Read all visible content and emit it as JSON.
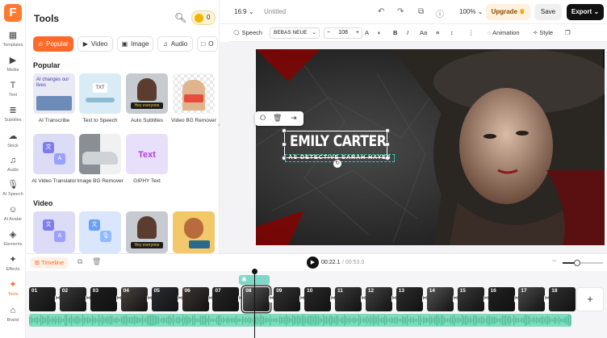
{
  "rail": {
    "items": [
      {
        "label": "Templates",
        "icon": "templates-icon"
      },
      {
        "label": "Media",
        "icon": "media-icon"
      },
      {
        "label": "Text",
        "icon": "text-icon"
      },
      {
        "label": "Subtitles",
        "icon": "subtitles-icon"
      },
      {
        "label": "Stock",
        "icon": "stock-icon"
      },
      {
        "label": "Audio",
        "icon": "audio-icon"
      },
      {
        "label": "AI Speech",
        "icon": "ai-speech-icon"
      },
      {
        "label": "AI Avatar",
        "icon": "ai-avatar-icon"
      },
      {
        "label": "Elements",
        "icon": "elements-icon"
      },
      {
        "label": "Effects",
        "icon": "effects-icon"
      },
      {
        "label": "Tools",
        "icon": "tools-icon",
        "active": true
      },
      {
        "label": "Brand",
        "icon": "brand-icon"
      }
    ]
  },
  "panel": {
    "title": "Tools",
    "coins": "0",
    "tabs": [
      "Popular",
      "Video",
      "Image",
      "Audio",
      "O"
    ],
    "popular_header": "Popular",
    "video_header": "Video",
    "popular_tools": [
      "AI Transcribe",
      "Text to Speech",
      "Auto Subtitles",
      "Video BG Remover",
      "AI Video Translator",
      "Image BG Remover",
      "GIPHY Text"
    ],
    "tile_texts": {
      "transcribe": "AI changes our lives",
      "tts_badge": "TXT",
      "hey_everyone": "Hey everyone",
      "giphy": "Text"
    }
  },
  "topbar": {
    "ratio": "16:9",
    "doc_title": "Untitled",
    "zoom": "100%",
    "upgrade": "Upgrade",
    "save": "Save",
    "export": "Export"
  },
  "formatbar": {
    "speech": "Speech",
    "font": "BEBAS NEUE",
    "size": "108",
    "animation": "Animation",
    "style": "Style"
  },
  "canvas": {
    "name_text": "EMILY CARTER",
    "sub_text": "AS DETECTIVE SARAH HAYES"
  },
  "timeline": {
    "label": "Timeline",
    "current_time": "00:22.1",
    "total_time": "/ 00:53.0",
    "zoom_fraction": 0.35,
    "clips": [
      "01",
      "02",
      "03",
      "04",
      "05",
      "06",
      "07",
      "08",
      "09",
      "10",
      "11",
      "12",
      "13",
      "14",
      "15",
      "16",
      "17",
      "18"
    ],
    "selected_clip": "08",
    "add_label": "+"
  },
  "colors": {
    "accent": "#ff6a2a",
    "audio": "#7fdcbc",
    "sticker": "#7fd7c6",
    "export": "#111111"
  }
}
